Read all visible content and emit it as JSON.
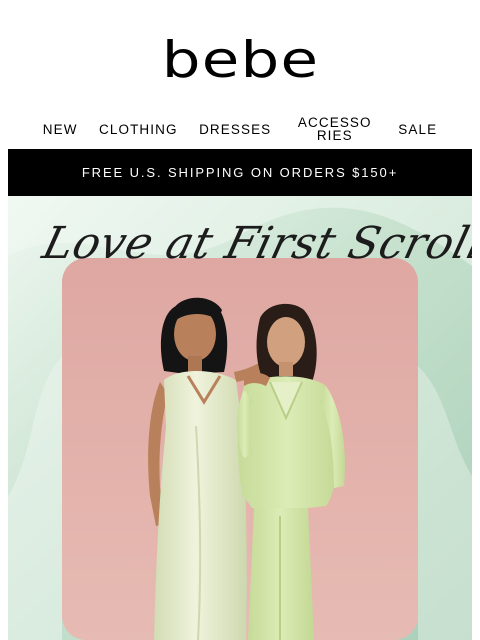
{
  "brand": {
    "logo_text": "bebe"
  },
  "nav": {
    "items": [
      {
        "label": "NEW"
      },
      {
        "label": "CLOTHING"
      },
      {
        "label": "DRESSES"
      },
      {
        "label": "ACCESSORIES"
      },
      {
        "label": "SALE"
      }
    ]
  },
  "promo_bar": {
    "text": "FREE U.S. SHIPPING ON ORDERS $150+"
  },
  "hero": {
    "title": "Love at First Scroll",
    "colors": {
      "background": "#bcdcc8",
      "panel": "#e2b1ab",
      "dress": "#e7ecd0",
      "suit": "#d6e7ad"
    }
  }
}
